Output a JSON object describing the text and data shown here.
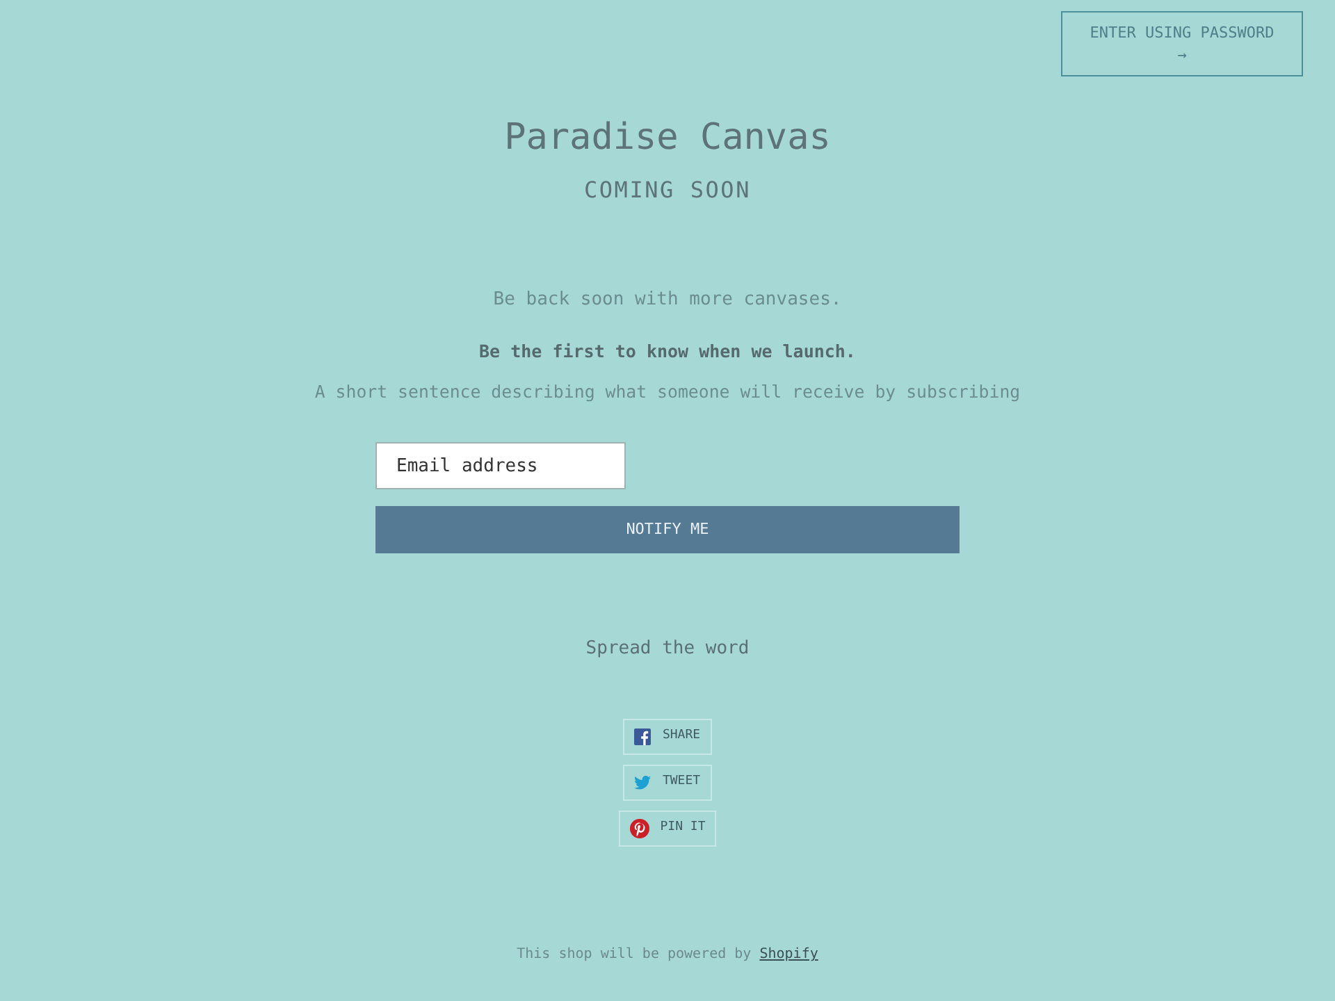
{
  "password_button": {
    "label": "ENTER USING PASSWORD",
    "arrow": "→"
  },
  "header": {
    "title": "Paradise Canvas",
    "subtitle": "COMING SOON"
  },
  "intro": "Be back soon with more canvases.",
  "newsletter": {
    "heading": "Be the first to know when we launch.",
    "description": "A short sentence describing what someone will receive by subscribing",
    "email": {
      "placeholder": "Email address"
    },
    "submit": "NOTIFY ME"
  },
  "share": {
    "heading": "Spread the word",
    "buttons": [
      {
        "kind": "facebook",
        "label": "SHARE"
      },
      {
        "kind": "twitter",
        "label": "TWEET"
      },
      {
        "kind": "pinterest",
        "label": "PIN IT"
      }
    ]
  },
  "footer": {
    "text": "This shop will be powered by",
    "link": "Shopify"
  }
}
